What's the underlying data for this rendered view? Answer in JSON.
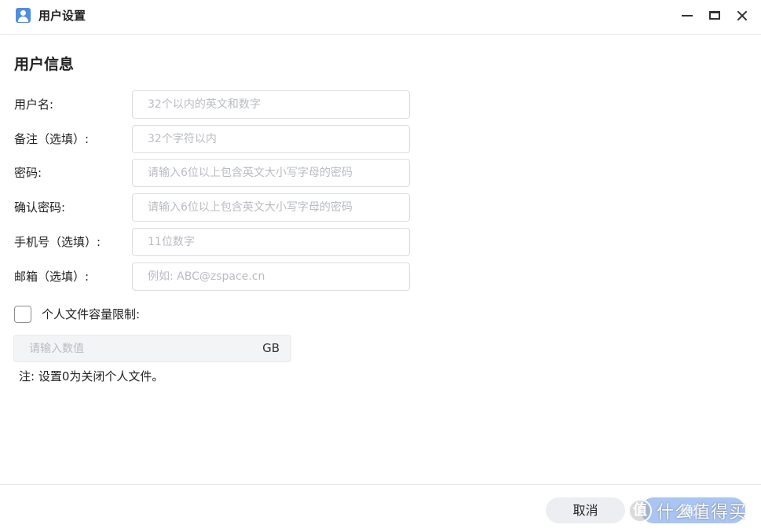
{
  "window": {
    "title": "用户设置",
    "icon": "user-icon"
  },
  "section": {
    "title": "用户信息"
  },
  "fields": {
    "username": {
      "label": "用户名:",
      "placeholder": "32个以内的英文和数字",
      "value": ""
    },
    "remark": {
      "label": "备注（选填）:",
      "placeholder": "32个字符以内",
      "value": ""
    },
    "password": {
      "label": "密码:",
      "placeholder": "请输入6位以上包含英文大小写字母的密码",
      "value": ""
    },
    "confirm_password": {
      "label": "确认密码:",
      "placeholder": "请输入6位以上包含英文大小写字母的密码",
      "value": ""
    },
    "phone": {
      "label": "手机号（选填）:",
      "placeholder": "11位数字",
      "value": ""
    },
    "email": {
      "label": "邮箱（选填）:",
      "placeholder": "例如: ABC@zspace.cn",
      "value": ""
    }
  },
  "quota": {
    "checkbox_label": "个人文件容量限制:",
    "checked": false,
    "placeholder": "请输入数值",
    "unit": "GB",
    "note": "注: 设置0为关闭个人文件。"
  },
  "footer": {
    "cancel_label": "取消",
    "confirm_label": "确定"
  },
  "watermark": {
    "logo_char": "值",
    "text": "什么值得买"
  },
  "colors": {
    "accent": "#4a90e2",
    "confirm_button": "#a9c5f3",
    "cancel_button": "#eceef1",
    "input_border": "#dcdde0",
    "placeholder": "#b9bcc2"
  }
}
